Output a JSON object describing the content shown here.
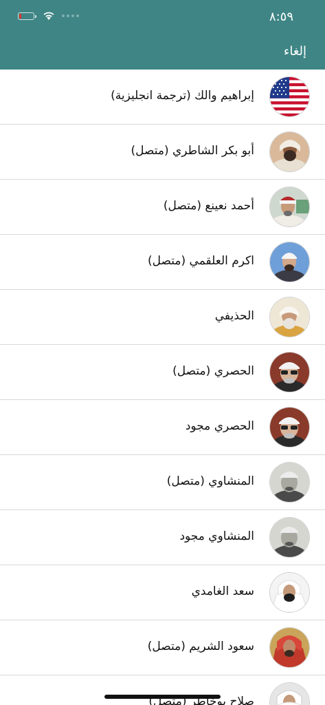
{
  "status_bar": {
    "time": "٨:٥٩"
  },
  "header": {
    "cancel_label": "إلغاء"
  },
  "colors": {
    "header_bg": "#3f8585",
    "battery_low": "#e0362c"
  },
  "reciters": [
    {
      "name": "إبراهيم والك (ترجمة انجليزية)",
      "avatar": "us-flag-icon"
    },
    {
      "name": "أبو بكر الشاطري (متصل)",
      "avatar": "reciter-photo"
    },
    {
      "name": "أحمد نعينع (متصل)",
      "avatar": "reciter-photo"
    },
    {
      "name": "اكرم العلقمي (متصل)",
      "avatar": "reciter-photo"
    },
    {
      "name": "الحذيفي",
      "avatar": "reciter-photo"
    },
    {
      "name": "الحصري (متصل)",
      "avatar": "reciter-photo"
    },
    {
      "name": "الحصري مجود",
      "avatar": "reciter-photo"
    },
    {
      "name": "المنشاوي (متصل)",
      "avatar": "reciter-photo"
    },
    {
      "name": "المنشاوي مجود",
      "avatar": "reciter-photo"
    },
    {
      "name": "سعد الغامدي",
      "avatar": "reciter-photo"
    },
    {
      "name": "سعود الشريم (متصل)",
      "avatar": "reciter-photo"
    },
    {
      "name": "صلاح بوخاطر (متصل)",
      "avatar": "reciter-photo"
    }
  ]
}
